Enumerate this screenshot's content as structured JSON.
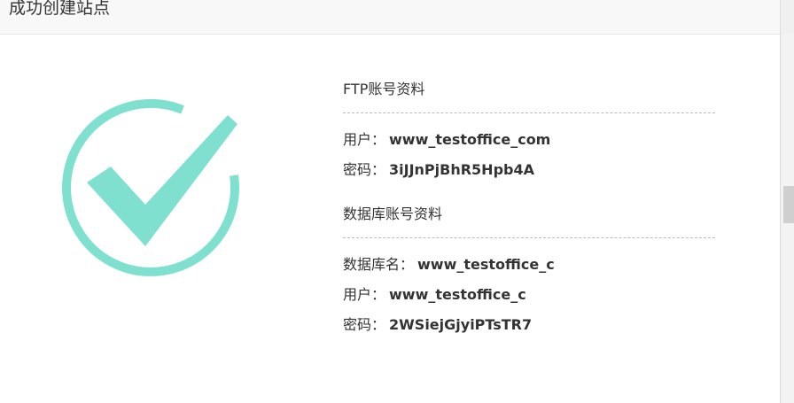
{
  "dialog": {
    "title": "成功创建站点"
  },
  "icons": {
    "success": "check-circle-icon",
    "accent_color": "#7fe0cf"
  },
  "ftp": {
    "heading": "FTP账号资料",
    "user_label": "用户：",
    "user_value": "www_testoffice_com",
    "password_label": "密码：",
    "password_value": "3iJJnPjBhR5Hpb4A"
  },
  "database": {
    "heading": "数据库账号资料",
    "name_label": "数据库名：",
    "name_value": "www_testoffice_c",
    "user_label": "用户：",
    "user_value": "www_testoffice_c",
    "password_label": "密码：",
    "password_value": "2WSiejGjyiPTsTR7"
  }
}
